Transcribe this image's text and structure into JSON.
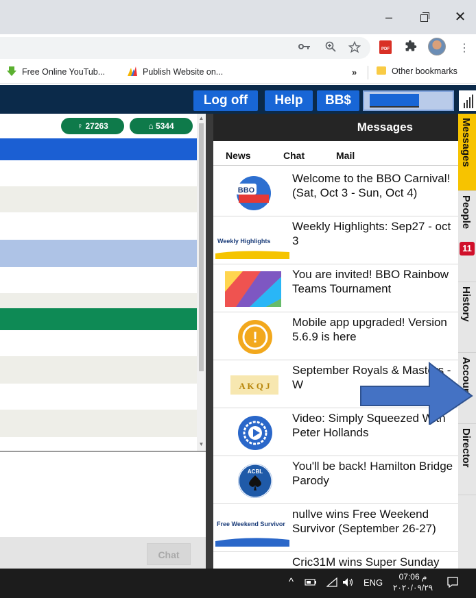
{
  "window": {
    "minimize": "–",
    "close": "✕"
  },
  "toolbar": {
    "key_icon": "key-icon",
    "zoom_icon": "zoom-icon",
    "star_icon": "star-icon",
    "pdf_label": "PDF",
    "menu_icon": "⋮"
  },
  "bookmarks": {
    "items": [
      {
        "label": "Free Online YouTub..."
      },
      {
        "label": "Publish Website on..."
      }
    ],
    "overflow": "»",
    "other": "Other bookmarks"
  },
  "bbo": {
    "logoff": "Log off",
    "help": "Help",
    "bbs": "BB$"
  },
  "lobby": {
    "users_count": "27263",
    "tables_count": "5344",
    "chat_button": "Chat"
  },
  "messages": {
    "title": "Messages",
    "tabs": [
      "News",
      "Chat",
      "Mail"
    ],
    "items": [
      {
        "text": "Welcome to the BBO Carnival! (Sat, Oct 3 - Sun, Oct 4)",
        "thumb_label": "BBO"
      },
      {
        "text": "Weekly Highlights: Sep27 - oct 3",
        "thumb_label": "Weekly Highlights"
      },
      {
        "text": "You are invited! BBO Rainbow Teams Tournament",
        "thumb_label": ""
      },
      {
        "text": "Mobile app upgraded! Version 5.6.9 is here",
        "thumb_label": "!"
      },
      {
        "text": "September Royals & Masters - W",
        "thumb_label": "A K Q J"
      },
      {
        "text": "Video: Simply Squeezed With Peter Hollands",
        "thumb_label": ""
      },
      {
        "text": "You'll be back! Hamilton Bridge Parody",
        "thumb_label": "ACBL"
      },
      {
        "text": "nullve wins Free Weekend Survivor (September 26-27)",
        "thumb_label": "Free Weekend Survivor"
      },
      {
        "text": "Cric31M wins Super Sunday",
        "thumb_label": ""
      }
    ]
  },
  "sidetabs": {
    "messages": "Messages",
    "people": "People",
    "people_badge": "11",
    "history": "History",
    "account": "Account",
    "director": "Director"
  },
  "taskbar": {
    "lang": "ENG",
    "time": "07:06 م",
    "date": "٢٠٢٠/٠٩/٢٩",
    "tray_up": "^"
  }
}
